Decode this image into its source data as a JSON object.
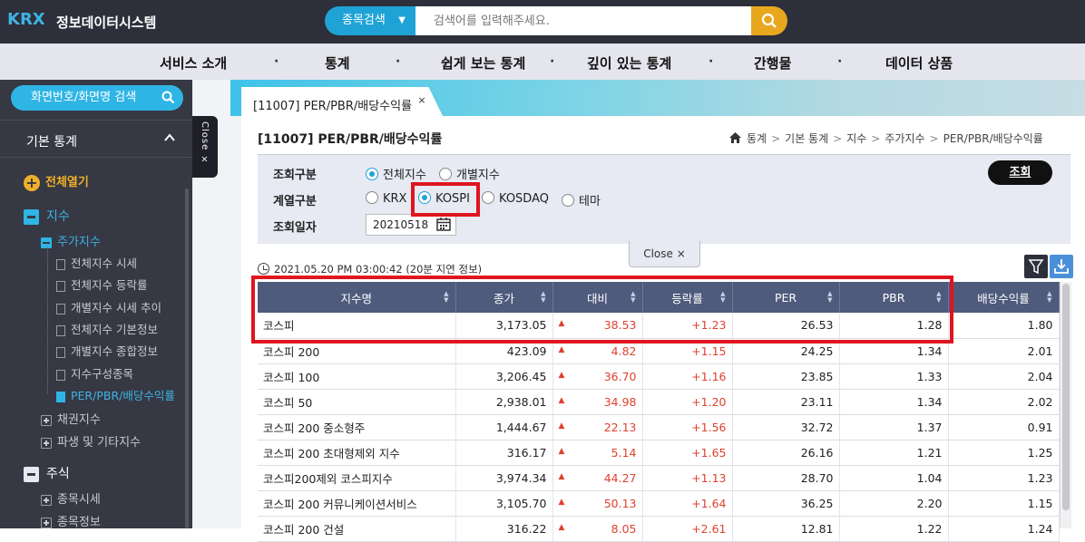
{
  "header": {
    "logo": "KRX",
    "title": "정보데이터시스템",
    "search_select_label": "종목검색",
    "search_placeholder": "검색어를 입력해주세요."
  },
  "gnb": {
    "items": [
      "서비스 소개",
      "통계",
      "쉽게 보는 통계",
      "깊이 있는 통계",
      "간행물",
      "데이터 상품"
    ],
    "separator": "·"
  },
  "sidebar": {
    "search_label": "화면번호/화면명 검색",
    "section_title": "기본 통계",
    "expand_all": "전체열기",
    "index": "지수",
    "stock_index": "주가지수",
    "sub_items": [
      "전체지수 시세",
      "전체지수 등락률",
      "개별지수 시세 추이",
      "전체지수 기본정보",
      "개별지수 종합정보",
      "지수구성종목",
      "PER/PBR/배당수익률"
    ],
    "bond_index": "채권지수",
    "derivative_index": "파생 및 기타지수",
    "stock": "주식",
    "stock_quote": "종목시세",
    "stock_info": "종목정보",
    "close_label": "Close ×"
  },
  "tab": {
    "label": "[11007] PER/PBR/배당수익률",
    "close": "×"
  },
  "page": {
    "title": "[11007] PER/PBR/배당수익률",
    "breadcrumb": [
      "통계",
      "기본 통계",
      "지수",
      "주가지수",
      "PER/PBR/배당수익률"
    ]
  },
  "filters": {
    "query_type_label": "조회구분",
    "query_type_options": [
      "전체지수",
      "개별지수"
    ],
    "query_type_selected": "전체지수",
    "series_label": "계열구분",
    "series_options": [
      "KRX",
      "KOSPI",
      "KOSDAQ",
      "테마"
    ],
    "series_selected": "KOSPI",
    "date_label": "조회일자",
    "date_value": "20210518",
    "query_button": "조회",
    "close_label": "Close ×"
  },
  "timestamp": "2021.05.20 PM 03:00:42 (20분 지연 정보)",
  "table": {
    "columns": [
      "지수명",
      "종가",
      "대비",
      "등락률",
      "PER",
      "PBR",
      "배당수익률"
    ],
    "rows": [
      {
        "name": "코스피",
        "close": "3,173.05",
        "change": "38.53",
        "rate": "+1.23",
        "per": "26.53",
        "pbr": "1.28",
        "div": "1.80"
      },
      {
        "name": "코스피 200",
        "close": "423.09",
        "change": "4.82",
        "rate": "+1.15",
        "per": "24.25",
        "pbr": "1.34",
        "div": "2.01"
      },
      {
        "name": "코스피 100",
        "close": "3,206.45",
        "change": "36.70",
        "rate": "+1.16",
        "per": "23.85",
        "pbr": "1.33",
        "div": "2.04"
      },
      {
        "name": "코스피 50",
        "close": "2,938.01",
        "change": "34.98",
        "rate": "+1.20",
        "per": "23.11",
        "pbr": "1.34",
        "div": "2.02"
      },
      {
        "name": "코스피 200 중소형주",
        "close": "1,444.67",
        "change": "22.13",
        "rate": "+1.56",
        "per": "32.72",
        "pbr": "1.37",
        "div": "0.91"
      },
      {
        "name": "코스피 200 초대형제외 지수",
        "close": "316.17",
        "change": "5.14",
        "rate": "+1.65",
        "per": "26.16",
        "pbr": "1.21",
        "div": "1.25"
      },
      {
        "name": "코스피200제외 코스피지수",
        "close": "3,974.34",
        "change": "44.27",
        "rate": "+1.13",
        "per": "28.70",
        "pbr": "1.04",
        "div": "1.23"
      },
      {
        "name": "코스피 200 커뮤니케이션서비스",
        "close": "3,105.70",
        "change": "50.13",
        "rate": "+1.64",
        "per": "36.25",
        "pbr": "2.20",
        "div": "1.15"
      },
      {
        "name": "코스피 200 건설",
        "close": "316.22",
        "change": "8.05",
        "rate": "+2.61",
        "per": "12.81",
        "pbr": "1.22",
        "div": "1.24"
      }
    ],
    "up_marker": "▲"
  },
  "colors": {
    "header_bg": "#2d2f3b",
    "accent_blue": "#1fa3d6",
    "search_btn": "#e8a81e",
    "highlight_red": "#e0141e",
    "table_header": "#4f5b7c",
    "up_red": "#e0412f"
  }
}
